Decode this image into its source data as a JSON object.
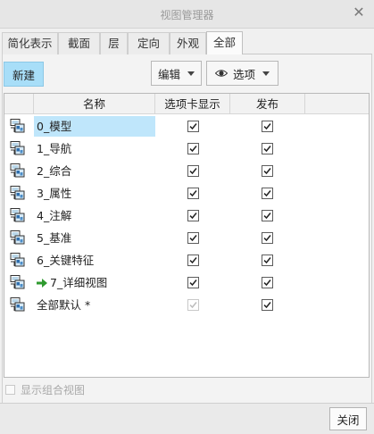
{
  "window": {
    "title": "视图管理器",
    "close_icon": "✕"
  },
  "tabs": [
    {
      "label": "简化表示",
      "active": false
    },
    {
      "label": "截面",
      "active": false
    },
    {
      "label": "层",
      "active": false
    },
    {
      "label": "定向",
      "active": false
    },
    {
      "label": "外观",
      "active": false
    },
    {
      "label": "全部",
      "active": true
    }
  ],
  "toolbar": {
    "new_label": "新建",
    "edit_label": "编辑",
    "options_label": "选项"
  },
  "table": {
    "columns": [
      "名称",
      "选项卡显示",
      "发布"
    ],
    "rows": [
      {
        "name": "0_模型",
        "selected": true,
        "active": false,
        "tab_display": true,
        "tab_disabled": false,
        "publish": true
      },
      {
        "name": "1_导航",
        "selected": false,
        "active": false,
        "tab_display": true,
        "tab_disabled": false,
        "publish": true
      },
      {
        "name": "2_综合",
        "selected": false,
        "active": false,
        "tab_display": true,
        "tab_disabled": false,
        "publish": true
      },
      {
        "name": "3_属性",
        "selected": false,
        "active": false,
        "tab_display": true,
        "tab_disabled": false,
        "publish": true
      },
      {
        "name": "4_注解",
        "selected": false,
        "active": false,
        "tab_display": true,
        "tab_disabled": false,
        "publish": true
      },
      {
        "name": "5_基准",
        "selected": false,
        "active": false,
        "tab_display": true,
        "tab_disabled": false,
        "publish": true
      },
      {
        "name": "6_关键特征",
        "selected": false,
        "active": false,
        "tab_display": true,
        "tab_disabled": false,
        "publish": true
      },
      {
        "name": "7_详细视图",
        "selected": false,
        "active": true,
        "tab_display": true,
        "tab_disabled": false,
        "publish": true
      },
      {
        "name": "全部默认 *",
        "selected": false,
        "active": false,
        "tab_display": true,
        "tab_disabled": true,
        "publish": true
      }
    ]
  },
  "footer": {
    "show_combined_label": "显示组合视图",
    "show_combined_checked": false,
    "close_label": "关闭"
  },
  "colors": {
    "selected_row": "#bfe6fb",
    "new_button": "#a8def8",
    "active_arrow": "#2e9a2e"
  }
}
